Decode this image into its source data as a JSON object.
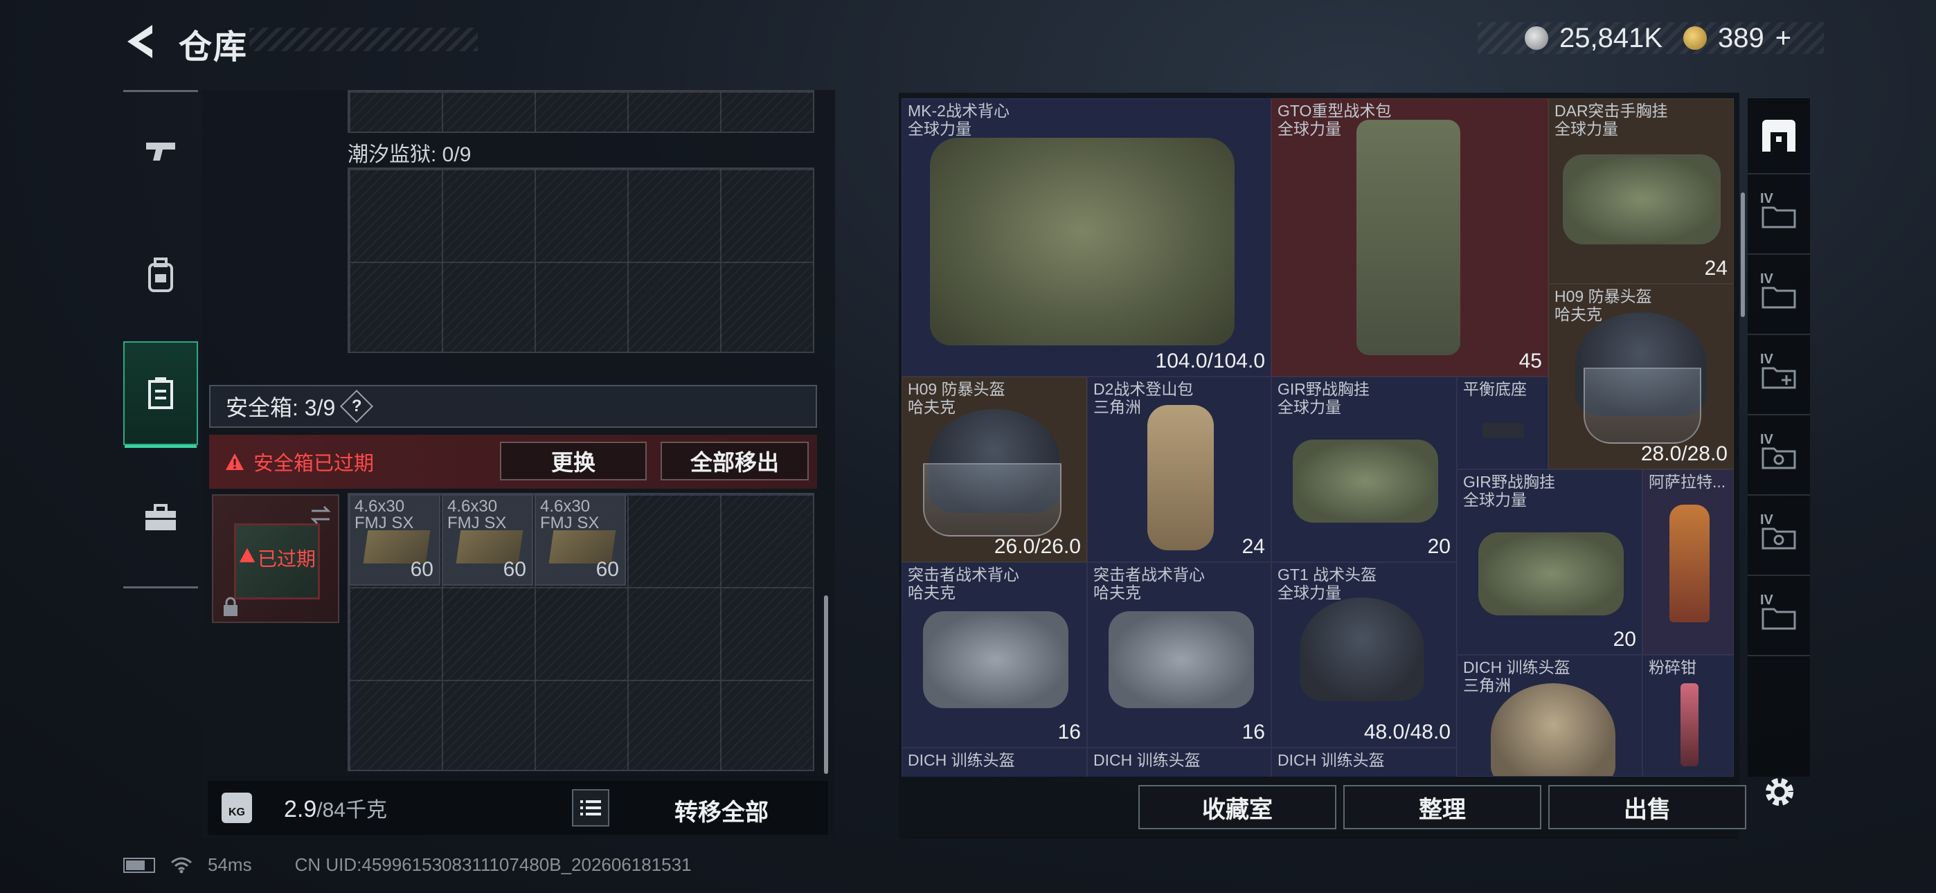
{
  "header": {
    "title": "仓库",
    "currency_silver": "25,841K",
    "currency_gold": "389",
    "add_label": "+"
  },
  "left_nav": {
    "items": [
      {
        "icon": "pistol-icon"
      },
      {
        "icon": "backpack-icon"
      },
      {
        "icon": "safebox-icon",
        "active": true
      },
      {
        "icon": "toolbox-icon"
      }
    ]
  },
  "containers": {
    "tide_prison_label": "潮汐监狱: 0/9",
    "safe_box_label": "安全箱: 3/9",
    "help_label": "?",
    "expired_notice": "安全箱已过期",
    "replace_button": "更换",
    "remove_all_button": "全部移出",
    "case_status": "已过期",
    "ammo": [
      {
        "name": "4.6x30",
        "sub": "FMJ SX",
        "count": "60"
      },
      {
        "name": "4.6x30",
        "sub": "FMJ SX",
        "count": "60"
      },
      {
        "name": "4.6x30",
        "sub": "FMJ SX",
        "count": "60"
      }
    ]
  },
  "weight": {
    "current": "2.9",
    "max": "/84千克",
    "icon_label": "KG"
  },
  "transfer_all_button": "转移全部",
  "stash": {
    "items": [
      {
        "name": "MK-2战术背心",
        "sub": "全球力量",
        "value": "104.0/104.0",
        "rarity": "blue"
      },
      {
        "name": "GTO重型战术包",
        "sub": "全球力量",
        "value": "45",
        "rarity": "red"
      },
      {
        "name": "DAR突击手胸挂",
        "sub": "全球力量",
        "value": "24",
        "rarity": "brown"
      },
      {
        "name": "H09 防暴头盔",
        "sub": "哈夫克",
        "value": "28.0/28.0",
        "rarity": "brown"
      },
      {
        "name": "H09 防暴头盔",
        "sub": "哈夫克",
        "value": "26.0/26.0",
        "rarity": "brown"
      },
      {
        "name": "D2战术登山包",
        "sub": "三角洲",
        "value": "24",
        "rarity": "blue"
      },
      {
        "name": "GIR野战胸挂",
        "sub": "全球力量",
        "value": "20",
        "rarity": "blue"
      },
      {
        "name": "平衡底座",
        "sub": "",
        "value": "",
        "rarity": "blue"
      },
      {
        "name": "GIR野战胸挂",
        "sub": "全球力量",
        "value": "20",
        "rarity": "blue"
      },
      {
        "name": "阿萨拉特...",
        "sub": "",
        "value": "",
        "rarity": "purple"
      },
      {
        "name": "突击者战术背心",
        "sub": "哈夫克",
        "value": "16",
        "rarity": "blue"
      },
      {
        "name": "突击者战术背心",
        "sub": "哈夫克",
        "value": "16",
        "rarity": "blue"
      },
      {
        "name": "GT1 战术头盔",
        "sub": "全球力量",
        "value": "48.0/48.0",
        "rarity": "blue"
      },
      {
        "name": "DICH 训练头盔",
        "sub": "三角洲",
        "value": "",
        "rarity": "blue"
      },
      {
        "name": "粉碎钳",
        "sub": "",
        "value": "",
        "rarity": "blue"
      },
      {
        "name": "DICH 训练头盔",
        "sub": "",
        "value": "",
        "rarity": "blue"
      },
      {
        "name": "DICH 训练头盔",
        "sub": "",
        "value": "",
        "rarity": "blue"
      },
      {
        "name": "DICH 训练头盔",
        "sub": "",
        "value": "",
        "rarity": "blue"
      }
    ]
  },
  "categories": [
    {
      "icon": "all-items-icon",
      "tag": ""
    },
    {
      "icon": "folder-icon",
      "tag": "IV"
    },
    {
      "icon": "folder-icon",
      "tag": "IV"
    },
    {
      "icon": "folder-add-icon",
      "tag": "IV"
    },
    {
      "icon": "camera-folder-icon",
      "tag": "IV"
    },
    {
      "icon": "camera-folder-icon",
      "tag": "IV"
    },
    {
      "icon": "folder-icon",
      "tag": "IV"
    }
  ],
  "bottom_buttons": {
    "collection": "收藏室",
    "organize": "整理",
    "sell": "出售"
  },
  "status": {
    "ping": "54ms",
    "uid": "CN UID:4599615308311107480B_202606181531"
  },
  "colors": {
    "accent_green": "#3ad39f",
    "warning_red": "#ff4a4a",
    "rarity_blue": "#222744",
    "rarity_red": "#4a2429",
    "rarity_brown": "#3b3027",
    "rarity_purple": "#2c2a45"
  }
}
